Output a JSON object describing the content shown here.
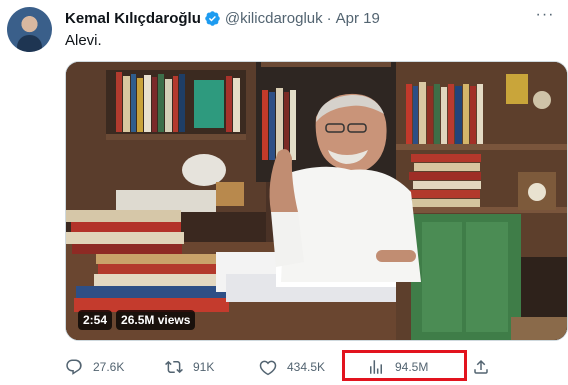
{
  "author": {
    "name": "Kemal Kılıçdaroğlu",
    "handle": "@kilicdarogluk",
    "separator": "·",
    "date": "Apr 19"
  },
  "tweet": {
    "text": "Alevi."
  },
  "video": {
    "duration": "2:54",
    "views": "26.5M views"
  },
  "actions": {
    "replies": "27.6K",
    "retweets": "91K",
    "likes": "434.5K",
    "views": "94.5M"
  },
  "colors": {
    "verified": "#1d9bf0",
    "highlight_box": "#e2131e",
    "secondary_text": "#536471"
  }
}
